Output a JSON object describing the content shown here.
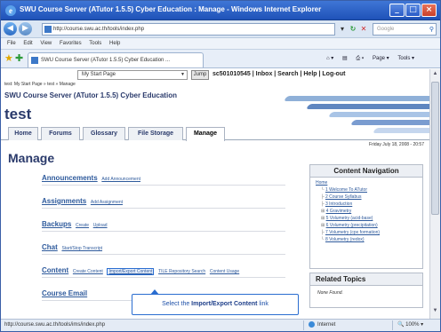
{
  "window": {
    "title": "SWU Course Server (ATutor 1.5.5) Cyber Education : Manage - Windows Internet Explorer",
    "min_glyph": "_",
    "max_glyph": "□",
    "close_glyph": "×"
  },
  "addressbar": {
    "url": "http://course.swu.ac.th/tools/index.php",
    "search_placeholder": "Google"
  },
  "menubar": [
    "File",
    "Edit",
    "View",
    "Favorites",
    "Tools",
    "Help"
  ],
  "browser_tab": {
    "title": "SWU Course Server (ATutor 1.5.5) Cyber Education ..."
  },
  "commandbar": {
    "page_label": "Page ▾",
    "tools_label": "Tools ▾"
  },
  "page": {
    "jump_select": "My Start Page",
    "jump_button": "Jump",
    "user_links": "sc501010545 | Inbox | Search | Help | Log-out",
    "breadcrumb": "test: My Start Page » test » Manage",
    "course_header": "SWU Course Server (ATutor 1.5.5) Cyber Education",
    "course_name": "test",
    "tabs": [
      {
        "label": "Home"
      },
      {
        "label": "Forums"
      },
      {
        "label": "Glossary"
      },
      {
        "label": "File Storage"
      },
      {
        "label": "Manage"
      }
    ],
    "date": "Friday July 18, 2008 - 20:57",
    "heading": "Manage",
    "tools": [
      {
        "name": "Announcements",
        "subs": [
          "Add Announcement"
        ]
      },
      {
        "name": "Assignments",
        "subs": [
          "Add Assignment"
        ]
      },
      {
        "name": "Backups",
        "subs": [
          "Create",
          "Upload"
        ]
      },
      {
        "name": "Chat",
        "subs": [
          "Start/Stop Transcript"
        ]
      },
      {
        "name": "Content",
        "subs": [
          "Create Content",
          "Import/Export Content",
          "TILE Repository Search",
          "Content Usage"
        ]
      },
      {
        "name": "Course Email",
        "subs": []
      }
    ],
    "content_nav": {
      "title": "Content Navigation",
      "home": "Home",
      "items": [
        {
          "tree": "└",
          "label": "1 Welcome To ATutor"
        },
        {
          "tree": "├",
          "label": "2 Course Syllabus"
        },
        {
          "tree": "├",
          "label": "3 Introduction"
        },
        {
          "tree": "⊞",
          "label": "4 Gravimetry"
        },
        {
          "tree": "⊞",
          "label": "5 Volumetry (acid-base)"
        },
        {
          "tree": "⊞",
          "label": "6 Volumetry (precipitation)"
        },
        {
          "tree": "├",
          "label": "7 Volumetry (cpx formation)"
        },
        {
          "tree": "└",
          "label": "8 Volumetry (redox)"
        }
      ]
    },
    "related": {
      "title": "Related Topics",
      "none": "None Found."
    },
    "callout": {
      "prefix": "Select the ",
      "bold": "Import/Export Content",
      "suffix": " link"
    }
  },
  "statusbar": {
    "url": "http://course.swu.ac.th/tools/ims/index.php",
    "zone": "Internet",
    "zoom": "100%"
  },
  "colors": {
    "titlebar": "#1f52b8",
    "link": "#2e5a9c",
    "heading": "#2a3a6b",
    "highlight": "#2a6dd0"
  }
}
